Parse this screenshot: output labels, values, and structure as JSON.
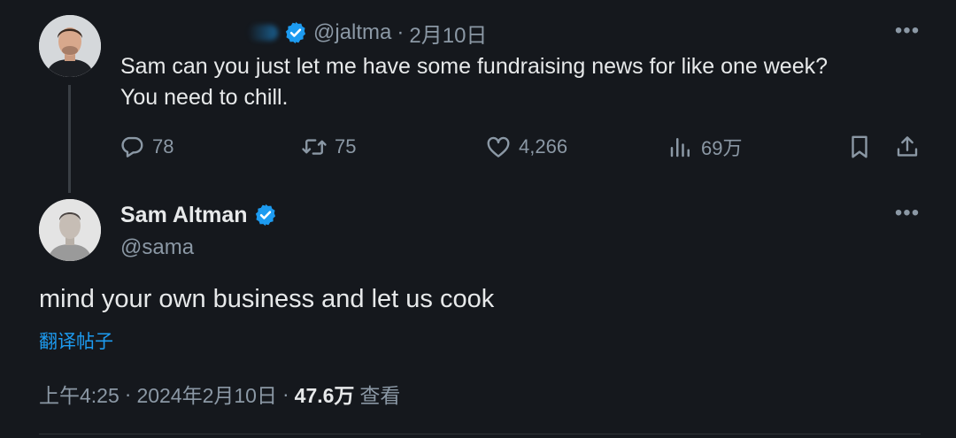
{
  "quoted_tweet": {
    "handle": "@jaltma",
    "separator": "·",
    "date": "2月10日",
    "text_line1": "Sam can you just let me have some fundraising news for like one week?",
    "text_line2": "You need to chill.",
    "more_label": "•••",
    "actions": {
      "replies": "78",
      "retweets": "75",
      "likes": "4,266",
      "views": "69万"
    }
  },
  "main_tweet": {
    "author_name": "Sam Altman",
    "author_handle": "@sama",
    "more_label": "•••",
    "text": "mind your own business and let us cook",
    "translate_label": "翻译帖子",
    "time": "上午4:25",
    "separator": "·",
    "date": "2024年2月10日",
    "views_count": "47.6万",
    "views_label": "查看"
  },
  "icons": {
    "verified": "verified-badge-icon",
    "reply": "reply-icon",
    "retweet": "retweet-icon",
    "like": "heart-icon",
    "views": "views-bar-chart-icon",
    "bookmark": "bookmark-icon",
    "share": "share-icon"
  },
  "colors": {
    "background": "#15181d",
    "text_primary": "#e7e9ea",
    "text_secondary": "#8b98a5",
    "accent": "#1d9bf0"
  }
}
